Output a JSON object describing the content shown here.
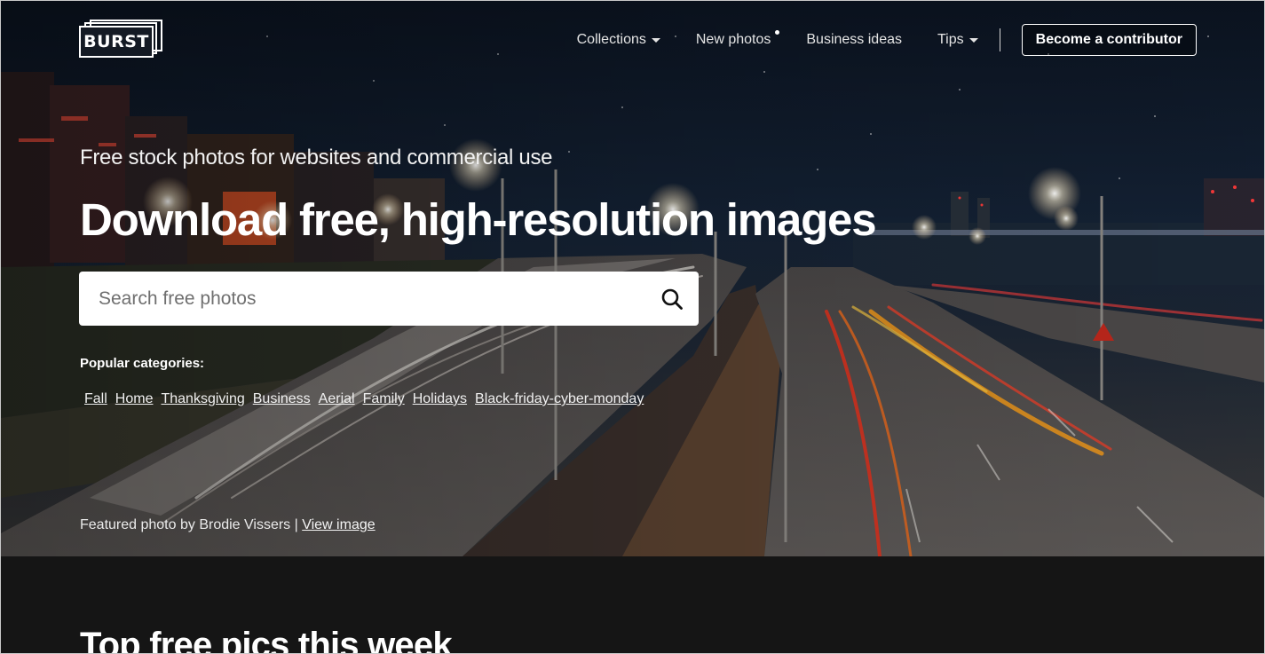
{
  "brand": {
    "logo_text": "BURST"
  },
  "nav": {
    "items": [
      {
        "label": "Collections",
        "has_dropdown": true
      },
      {
        "label": "New photos",
        "has_new_indicator": true
      },
      {
        "label": "Business ideas"
      },
      {
        "label": "Tips",
        "has_dropdown": true
      }
    ],
    "contributor_button": "Become a contributor"
  },
  "hero": {
    "tagline": "Free stock photos for websites and commercial use",
    "headline": "Download free, high-resolution images",
    "search": {
      "placeholder": "Search free photos",
      "value": ""
    },
    "popular_label": "Popular categories:",
    "categories": [
      "Fall",
      "Home",
      "Thanksgiving",
      "Business",
      "Aerial",
      "Family",
      "Holidays",
      "Black-friday-cyber-monday"
    ],
    "credit": {
      "text": "Featured photo by Brodie Vissers | ",
      "link": "View image"
    }
  },
  "section": {
    "title": "Top free pics this week"
  },
  "colors": {
    "background": "#151515",
    "text_primary": "#ffffff",
    "search_bg": "#ffffff",
    "placeholder": "#6f6f6f"
  },
  "icons": {
    "search": "search-icon",
    "dropdown": "caret-down-icon"
  }
}
